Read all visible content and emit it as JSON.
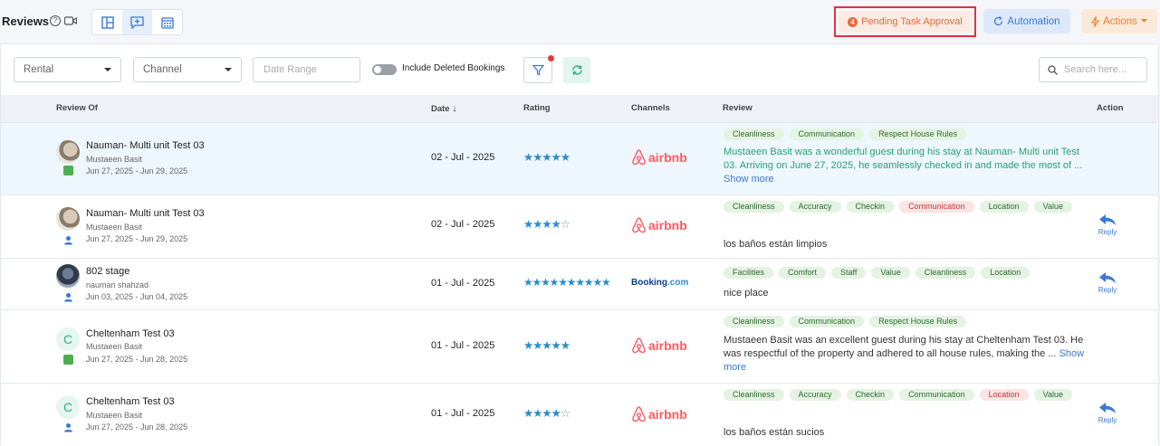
{
  "header": {
    "title": "Reviews",
    "help": "?",
    "pending": {
      "count": "4",
      "label": "Pending Task Approval"
    },
    "automation": "Automation",
    "actions": "Actions"
  },
  "filters": {
    "rental": "Rental",
    "channel": "Channel",
    "date_placeholder": "Date Range",
    "include_deleted": "Include Deleted Bookings",
    "search_placeholder": "Search here..."
  },
  "columns": {
    "review_of": "Review Of",
    "date": "Date",
    "date_sort": "↓",
    "rating": "Rating",
    "channels": "Channels",
    "review": "Review",
    "action": "Action"
  },
  "rows": [
    {
      "property": "Nauman- Multi unit Test 03",
      "guest": "Mustaeen Basit",
      "stay": "Jun 27, 2025 - Jun 29, 2025",
      "date": "02 - Jul - 2025",
      "stars": "★★★★★",
      "stars_empty": "",
      "channel": "airbnb",
      "tags": [
        "Cleanliness",
        "Communication",
        "Respect House Rules"
      ],
      "review": "Mustaeen Basit was a wonderful guest during his stay at Nauman- Multi unit Test 03. Arriving on June 27, 2025, he seamlessly checked in and made the most of ...",
      "show_more": "Show more",
      "reply": ""
    },
    {
      "property": "Nauman- Multi unit Test 03",
      "guest": "Mustaeen Basit",
      "stay": "Jun 27, 2025 - Jun 29, 2025",
      "date": "02 - Jul - 2025",
      "stars": "★★★★",
      "stars_empty": "☆",
      "channel": "airbnb",
      "tags": [
        "Cleanliness",
        "Accuracy",
        "Checkin",
        "Communication",
        "Location",
        "Value"
      ],
      "review": "los baños están limpios",
      "show_more": "",
      "reply": "Reply"
    },
    {
      "property": "802 stage",
      "guest": "nauman shahzad",
      "stay": "Jun 03, 2025 - Jun 04, 2025",
      "date": "01 - Jul - 2025",
      "stars": "★★★★★★★★★★",
      "stars_empty": "",
      "channel_booking": "Booking",
      "channel_booking_suffix": ".com",
      "tags": [
        "Facilities",
        "Comfort",
        "Staff",
        "Value",
        "Cleanliness",
        "Location"
      ],
      "review": "nice place",
      "show_more": "",
      "reply": "Reply"
    },
    {
      "property": "Cheltenham Test 03",
      "guest": "Mustaeen Basit",
      "stay": "Jun 27, 2025 - Jun 28, 2025",
      "date": "01 - Jul - 2025",
      "stars": "★★★★★",
      "stars_empty": "",
      "channel": "airbnb",
      "initial": "C",
      "tags": [
        "Cleanliness",
        "Communication",
        "Respect House Rules"
      ],
      "review": "Mustaeen Basit was an excellent guest during his stay at Cheltenham Test 03. He was respectful of the property and adhered to all house rules, making the ...",
      "show_more": "Show more",
      "reply": ""
    },
    {
      "property": "Cheltenham Test 03",
      "guest": "Mustaeen Basit",
      "stay": "Jun 27, 2025 - Jun 28, 2025",
      "date": "01 - Jul - 2025",
      "stars": "★★★★",
      "stars_empty": "☆",
      "channel": "airbnb",
      "initial": "C",
      "tags": [
        "Cleanliness",
        "Accuracy",
        "Checkin",
        "Communication",
        "Location",
        "Value"
      ],
      "review": "los baños están sucios",
      "show_more": "",
      "reply": "Reply"
    }
  ],
  "colors": {
    "accent": "#3b78d6",
    "pending_border": "#d9363e",
    "star": "#2a8cc7",
    "airbnb": "#ff5a5f"
  }
}
